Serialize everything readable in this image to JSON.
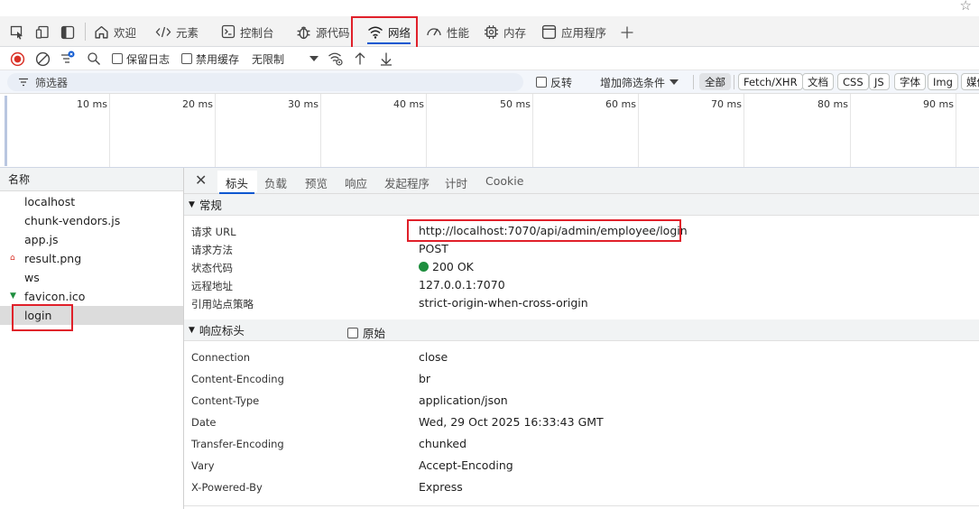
{
  "main_tabs": [
    {
      "label": "欢迎",
      "icon": "home-icon"
    },
    {
      "label": "元素",
      "icon": "code-icon"
    },
    {
      "label": "控制台",
      "icon": "terminal-icon"
    },
    {
      "label": "源代码",
      "icon": "bug-icon"
    },
    {
      "label": "网络",
      "icon": "wifi-icon",
      "active": true
    },
    {
      "label": "性能",
      "icon": "performance-icon"
    },
    {
      "label": "内存",
      "icon": "chip-icon"
    },
    {
      "label": "应用程序",
      "icon": "app-window-icon"
    }
  ],
  "toolbar": {
    "preserve_log_label": "保留日志",
    "disable_cache_label": "禁用缓存",
    "throttling_value": "无限制"
  },
  "filter": {
    "placeholder": "筛选器",
    "invert_label": "反转",
    "more_filters_label": "增加筛选条件",
    "types": [
      "全部",
      "Fetch/XHR",
      "文档",
      "CSS",
      "JS",
      "字体",
      "Img",
      "媒体"
    ]
  },
  "timeline": {
    "ticks": [
      "10 ms",
      "20 ms",
      "30 ms",
      "40 ms",
      "50 ms",
      "60 ms",
      "70 ms",
      "80 ms",
      "90 ms"
    ]
  },
  "request_list": {
    "header": "名称",
    "items": [
      {
        "name": "localhost"
      },
      {
        "name": "chunk-vendors.js"
      },
      {
        "name": "app.js"
      },
      {
        "name": "result.png"
      },
      {
        "name": "ws"
      },
      {
        "name": "favicon.ico"
      },
      {
        "name": "login",
        "selected": true
      }
    ]
  },
  "detail_tabs": [
    "标头",
    "负载",
    "预览",
    "响应",
    "发起程序",
    "计时",
    "Cookie"
  ],
  "general": {
    "title": "常规",
    "rows": [
      {
        "key": "请求 URL",
        "value": "http://localhost:7070/api/admin/employee/login"
      },
      {
        "key": "请求方法",
        "value": "POST"
      },
      {
        "key": "状态代码",
        "value": "200 OK"
      },
      {
        "key": "远程地址",
        "value": "127.0.0.1:7070"
      },
      {
        "key": "引用站点策略",
        "value": "strict-origin-when-cross-origin"
      }
    ]
  },
  "response_headers": {
    "title": "响应标头",
    "raw_label": "原始",
    "rows": [
      {
        "key": "Connection",
        "value": "close"
      },
      {
        "key": "Content-Encoding",
        "value": "br"
      },
      {
        "key": "Content-Type",
        "value": "application/json"
      },
      {
        "key": "Date",
        "value": "Wed, 29 Oct 2025 16:33:43 GMT"
      },
      {
        "key": "Transfer-Encoding",
        "value": "chunked"
      },
      {
        "key": "Vary",
        "value": "Accept-Encoding"
      },
      {
        "key": "X-Powered-By",
        "value": "Express"
      }
    ]
  },
  "colors": {
    "accent": "#0b57d0",
    "highlight_box": "#e0202a",
    "status_ok": "#1e8e3e",
    "record_red": "#d93025"
  }
}
